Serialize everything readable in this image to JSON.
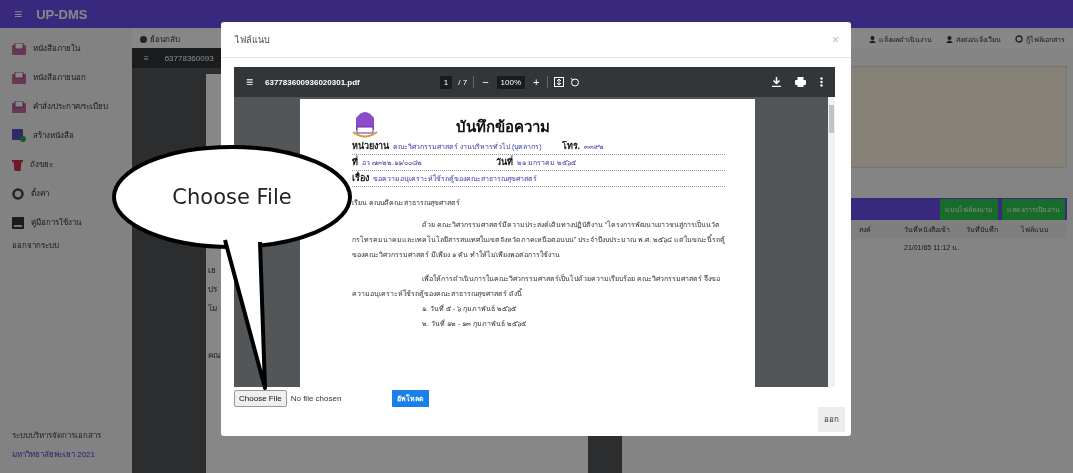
{
  "app": {
    "menu_icon": "≡",
    "title": "UP-DMS"
  },
  "sidebar": {
    "items": [
      {
        "label": "หนังสือภายใน",
        "kind": "inbox"
      },
      {
        "label": "หนังสือภายนอก",
        "kind": "outbox"
      },
      {
        "label": "คำสั่ง/ประกาศ/ระเบียบ",
        "kind": "order"
      },
      {
        "label": "สร้างหนังสือ",
        "kind": "create"
      },
      {
        "label": "ถังขยะ",
        "kind": "trash"
      },
      {
        "label": "ตั้งค่า",
        "kind": "settings"
      },
      {
        "label": "คู่มือการใช้งาน",
        "kind": "manual"
      }
    ],
    "logout": "ออกจากระบบ",
    "footer_title": "ระบบบริหารจัดการเอกสาร",
    "footer_link": "มหาวิทยาลัยพะเยา 2021"
  },
  "toolbar": {
    "back": "ย้อนกลับ",
    "actions": [
      "แจ้งผลดำเนินงาน",
      "ส่งต่อ/แจ้งเวียน",
      "กู้ไฟล์เอกสาร"
    ]
  },
  "background_viewer": {
    "menu_icon": "≡",
    "file_name": "63778360093",
    "text_fragments": [
      "เย",
      "ปร",
      "โม",
      "คณ"
    ]
  },
  "record_panel": {
    "buttons": [
      "แนบไฟล์ลงนาม",
      "แสดงการเปิดอ่าน"
    ],
    "columns": [
      "สงค์",
      "วันที่หนังสือเข้า",
      "วันที่บันทึก",
      "ไฟล์แนบ"
    ],
    "row_date_in": "21/01/65 11:12 น."
  },
  "modal": {
    "title": "ไฟล์แนบ",
    "close": "×",
    "viewer": {
      "menu_icon": "≡",
      "file_name": "637783600936020301.pdf",
      "page": "1",
      "page_count": "/ 7",
      "zoom_out": "−",
      "zoom": "100%",
      "zoom_in": "+",
      "document": {
        "heading": "บันทึกข้อความ",
        "fields": [
          {
            "label": "หน่วยงาน",
            "value": "คณะวิศวกรรมศาสตร์ งานบริหารทั่วไป (บุคลากร)",
            "label_2": "โทร.",
            "value_2": "๓๓๙๒"
          },
          {
            "label": "ที่",
            "value": "อว ๗๓๒๒.๑๑/๐๐๘๒",
            "label_2": "วันที่",
            "value_2": "๒๑ มกราคม ๒๕๖๕"
          },
          {
            "label": "เรื่อง",
            "value": "ขอความอนุเคราะห์ใช้รถตู้ของคณะสาธารณสุขศาสตร์"
          }
        ],
        "salutation": "เรียน คณบดีคณะสาธารณสุขศาสตร์",
        "paragraphs": [
          "ด้วย คณะวิศวกรรมศาสตร์มีความประสงค์เดินทางปฏิบัติงาน “โครงการพัฒนาเยาวชนสู่การเป็นนวัตกรโทรคมนาคมและเทคโนโลยีสารสนเทศในเขตจังหวัดภาคเหนือตอนบน” ประจำปีงบประมาณ พ.ศ. ๒๕๖๔ แต่ในขณะนี้รถตู้ ของคณะวิศวกรรมศาสตร์ มีเพียง ๑ คัน ทำให้ไม่เพียงพอต่อการใช้งาน",
          "เพื่อให้การดำเนินการในคณะวิศวกรรมศาสตร์เป็นไปด้วยความเรียบร้อย คณะวิศวกรรมศาสตร์ จึงขอความอนุเคราะห์ใช้รถตู้ของคณะสาธารณสุขศาสตร์ ดังนี้"
        ],
        "list": [
          "๑. วันที่ ๕ - ๖ กุมภาพันธ์ ๒๕๖๕",
          "๒. วันที่ ๑๒ - ๑๓ กุมภาพันธ์ ๒๕๖๕"
        ]
      }
    },
    "file_input": {
      "button": "Choose File",
      "status": "No file chosen"
    },
    "upload": "อัพโหลด",
    "exit": "ออก"
  },
  "annotation": {
    "text": "Choose File"
  }
}
